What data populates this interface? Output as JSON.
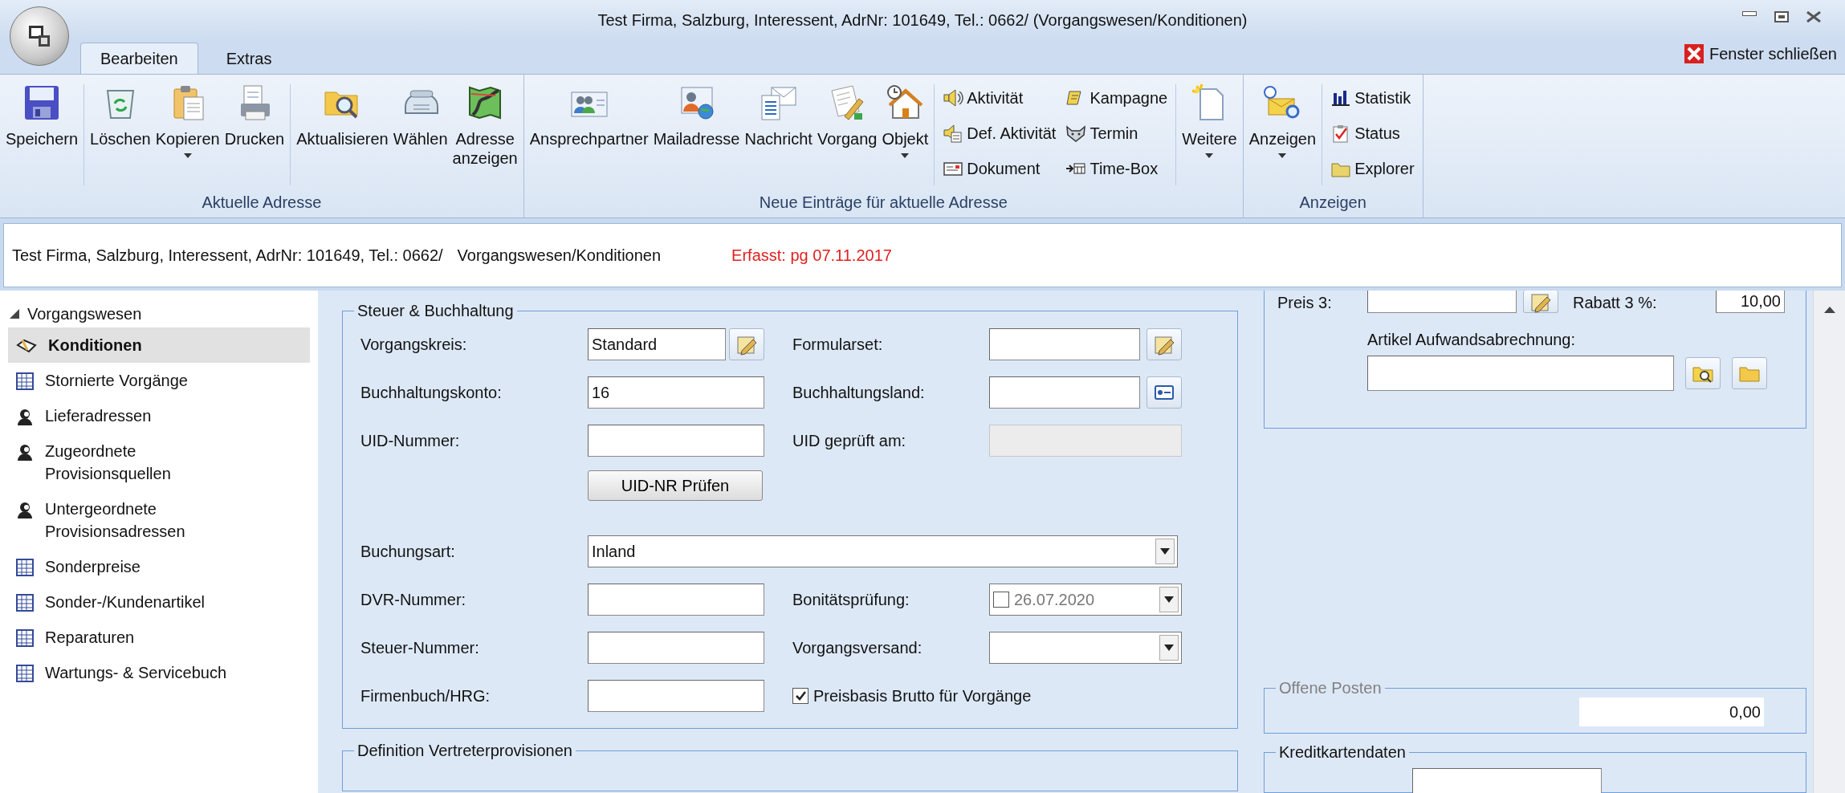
{
  "window": {
    "title": "Test Firma, Salzburg, Interessent, AdrNr: 101649, Tel.: 0662/ (Vorgangswesen/Konditionen)"
  },
  "tabs": [
    {
      "label": "Bearbeiten",
      "selected": true
    },
    {
      "label": "Extras",
      "selected": false
    }
  ],
  "close_window": "Fenster schließen",
  "ribbon": {
    "groups": [
      {
        "label": "Aktuelle Adresse",
        "items": [
          {
            "kind": "large",
            "label": "Speichern",
            "dropdown": false
          },
          {
            "kind": "separator"
          },
          {
            "kind": "large",
            "label": "Löschen",
            "dropdown": false
          },
          {
            "kind": "large",
            "label": "Kopieren",
            "dropdown": true
          },
          {
            "kind": "large",
            "label": "Drucken",
            "dropdown": false
          },
          {
            "kind": "separator"
          },
          {
            "kind": "large",
            "label": "Aktualisieren",
            "dropdown": false
          },
          {
            "kind": "large",
            "label": "Wählen",
            "dropdown": false
          },
          {
            "kind": "large",
            "label": "Adresse\nanzeigen",
            "dropdown": false
          }
        ]
      },
      {
        "label": "Neue Einträge für aktuelle Adresse",
        "items": [
          {
            "kind": "large",
            "label": "Ansprechpartner",
            "dropdown": false
          },
          {
            "kind": "large",
            "label": "Mailadresse",
            "dropdown": false
          },
          {
            "kind": "large",
            "label": "Nachricht",
            "dropdown": false
          },
          {
            "kind": "large",
            "label": "Vorgang",
            "dropdown": false
          },
          {
            "kind": "large",
            "label": "Objekt",
            "dropdown": true
          },
          {
            "kind": "separator"
          },
          {
            "kind": "small_column",
            "buttons": [
              "Aktivität",
              "Def. Aktivität",
              "Dokument"
            ]
          },
          {
            "kind": "small_column",
            "buttons": [
              "Kampagne",
              "Termin",
              "Time-Box"
            ]
          },
          {
            "kind": "separator"
          },
          {
            "kind": "large",
            "label": "Weitere",
            "dropdown": true
          }
        ]
      },
      {
        "label": "Anzeigen",
        "items": [
          {
            "kind": "large",
            "label": "Anzeigen",
            "dropdown": true
          },
          {
            "kind": "separator"
          },
          {
            "kind": "small_column",
            "buttons": [
              "Statistik",
              "Status",
              "Explorer"
            ]
          }
        ]
      }
    ]
  },
  "address_bar": {
    "address": "Test Firma, Salzburg, Interessent, AdrNr: 101649, Tel.: 0662/",
    "path": "Vorgangswesen/Konditionen",
    "created": "Erfasst: pg 07.11.2017"
  },
  "sidebar": {
    "tree": [
      {
        "label": "Vorgangswesen",
        "expanded": true,
        "children": [
          {
            "label": "Konditionen",
            "kind": "edit",
            "selected": true
          },
          {
            "label": "Stornierte Vorgänge",
            "kind": "table",
            "selected": false
          },
          {
            "label": "Lieferadressen",
            "kind": "person",
            "selected": false
          },
          {
            "label": "Zugeordnete\nProvisionsquellen",
            "kind": "person",
            "selected": false
          },
          {
            "label": "Untergeordnete\nProvisionsadressen",
            "kind": "person",
            "selected": false
          },
          {
            "label": "Sonderpreise",
            "kind": "table",
            "selected": false
          },
          {
            "label": "Sonder-/Kundenartikel",
            "kind": "table",
            "selected": false
          },
          {
            "label": "Reparaturen",
            "kind": "table",
            "selected": false
          },
          {
            "label": "Wartungs- & Servicebuch",
            "kind": "table",
            "selected": false
          }
        ]
      }
    ]
  },
  "tax_section": {
    "title": "Steuer & Buchhaltung",
    "rows": [
      {
        "kind": "pair",
        "cells": [
          {
            "label": "Vorgangskreis:",
            "field": {
              "kind": "textedit",
              "value": "Standard"
            }
          },
          {
            "label": "Formularset:",
            "field": {
              "kind": "textedit"
            }
          }
        ]
      },
      {
        "kind": "pair",
        "cells": [
          {
            "label": "Buchhaltungskonto:",
            "field": {
              "kind": "text",
              "value": "16"
            }
          },
          {
            "label": "Buchhaltungsland:",
            "field": {
              "kind": "textcard"
            }
          }
        ]
      },
      {
        "kind": "pair",
        "cells": [
          {
            "label": "UID-Nummer:",
            "field": {
              "kind": "text"
            }
          },
          {
            "label": "UID geprüft am:",
            "field": {
              "kind": "text",
              "disabled": true
            }
          }
        ]
      },
      {
        "kind": "button",
        "label": "UID-NR Prüfen"
      },
      {
        "kind": "wide",
        "label": "Buchungsart:",
        "field": {
          "kind": "combo",
          "value": "Inland"
        }
      },
      {
        "kind": "pair",
        "cells": [
          {
            "label": "DVR-Nummer:",
            "field": {
              "kind": "text"
            }
          },
          {
            "label": "Bonitätsprüfung:",
            "field": {
              "kind": "datecombo",
              "checked": false,
              "value": "26.07.2020"
            }
          }
        ]
      },
      {
        "kind": "pair",
        "cells": [
          {
            "label": "Steuer-Nummer:",
            "field": {
              "kind": "text"
            }
          },
          {
            "label": "Vorgangsversand:",
            "field": {
              "kind": "combo"
            }
          }
        ]
      },
      {
        "kind": "pair",
        "cells": [
          {
            "label": "Firmenbuch/HRG:",
            "field": {
              "kind": "text"
            }
          },
          {
            "field": {
              "kind": "checkbox",
              "checked": true,
              "label": "Preisbasis Brutto für Vorgänge"
            }
          }
        ]
      }
    ]
  },
  "commission_section": {
    "title": "Definition Vertreterprovisionen"
  },
  "prices": {
    "price_label": "Preis 3:",
    "discount_label": "Rabatt 3 %:",
    "discount_value": "10,00",
    "article_label": "Artikel Aufwandsabrechnung:"
  },
  "open_items": {
    "title": "Offene Posten",
    "disabled": true,
    "amount": "0,00"
  },
  "credit_card": {
    "title": "Kreditkartendaten"
  }
}
